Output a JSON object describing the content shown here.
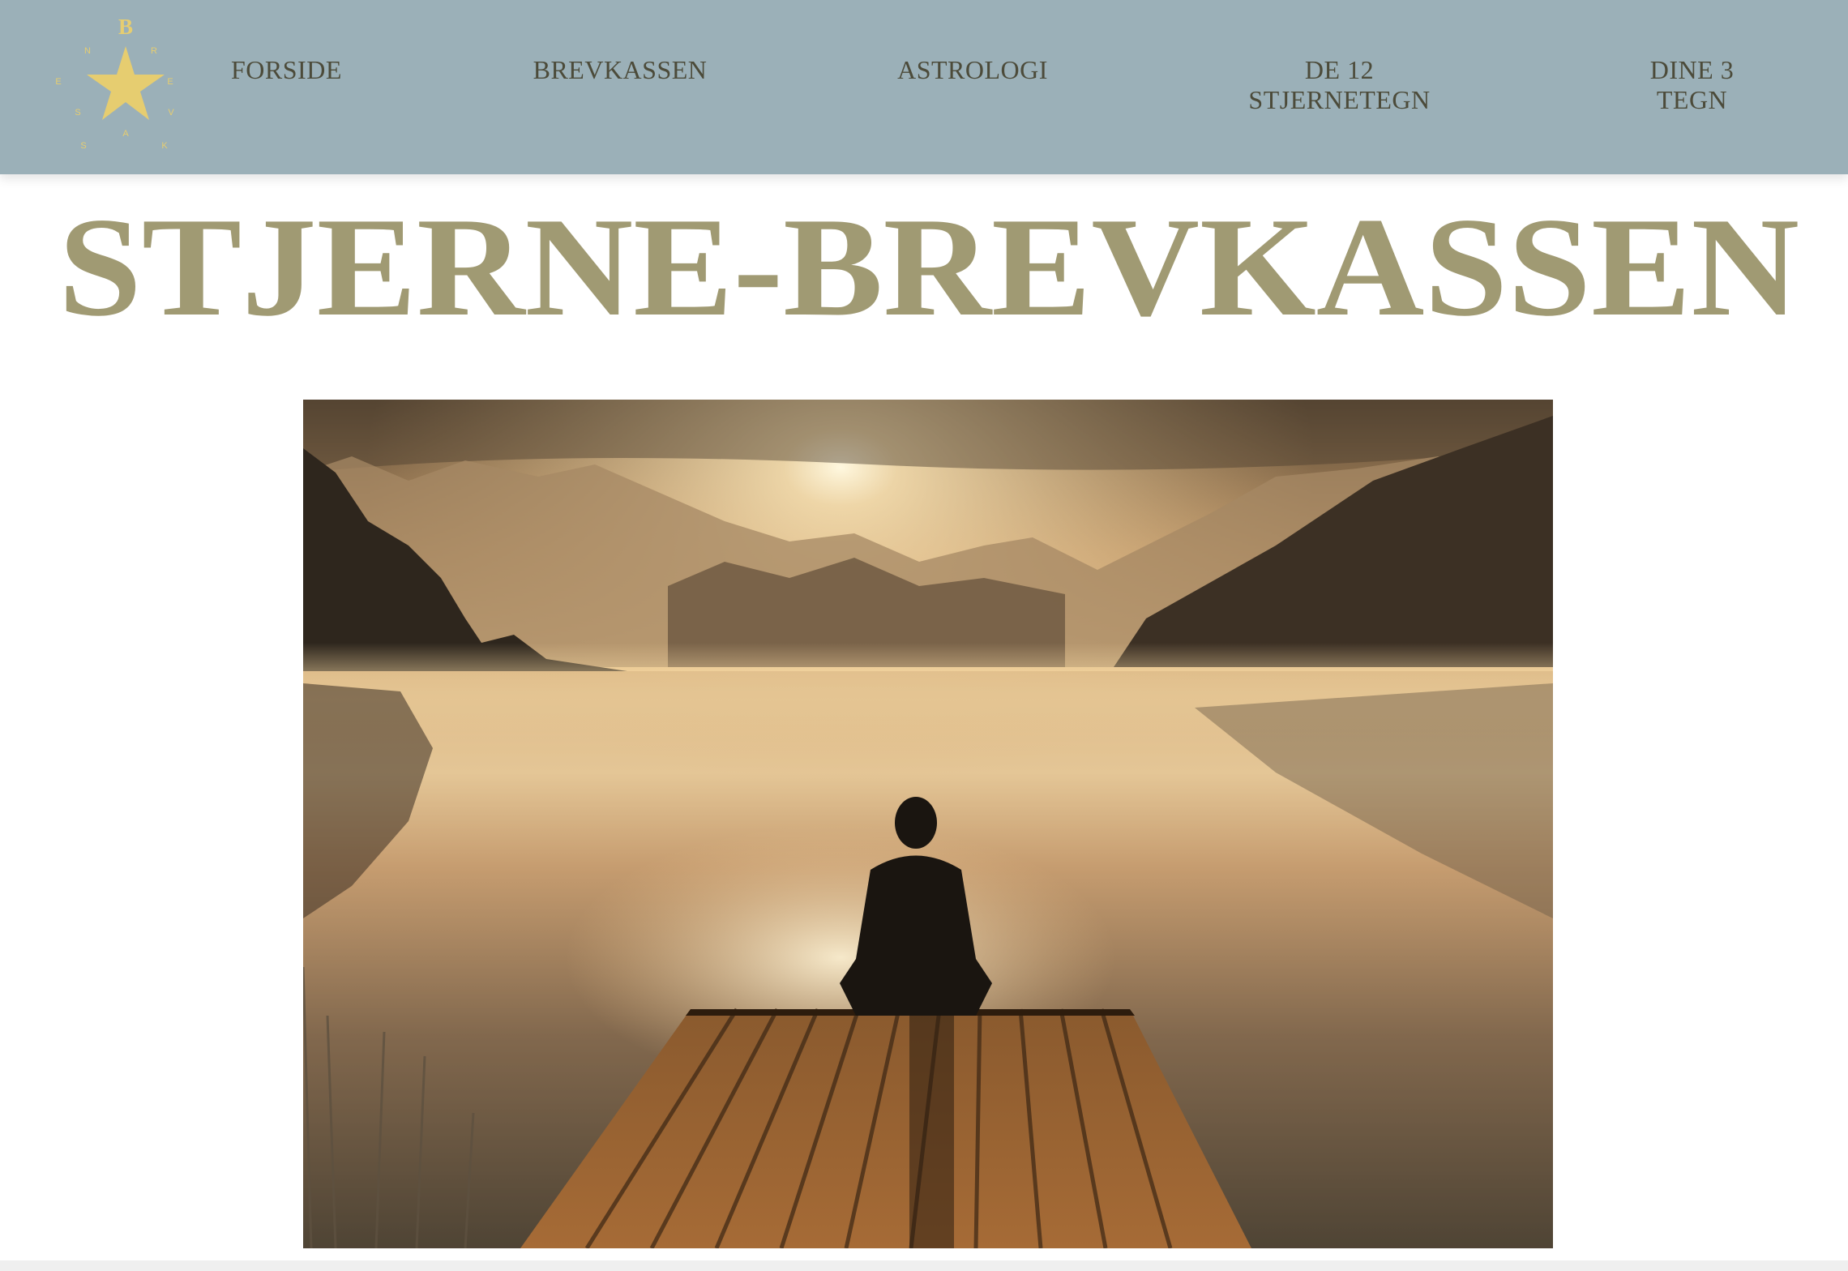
{
  "brand": {
    "logo_letters": [
      "B",
      "R",
      "E",
      "V",
      "K",
      "A",
      "S",
      "S",
      "E",
      "N"
    ],
    "logo_color": "#e6cd70"
  },
  "nav": {
    "items": [
      {
        "lines": [
          "FORSIDE"
        ]
      },
      {
        "lines": [
          "BREVKASSEN"
        ]
      },
      {
        "lines": [
          "ASTROLOGI"
        ]
      },
      {
        "lines": [
          "DE 12",
          "STJERNETEGN"
        ]
      },
      {
        "lines": [
          "DINE 3",
          "TEGN"
        ]
      }
    ],
    "bar_color": "#9bb0b8",
    "text_color": "#4c4b3a"
  },
  "page": {
    "title": "STJERNE-BREVKASSEN",
    "title_color": "#a09a73"
  }
}
